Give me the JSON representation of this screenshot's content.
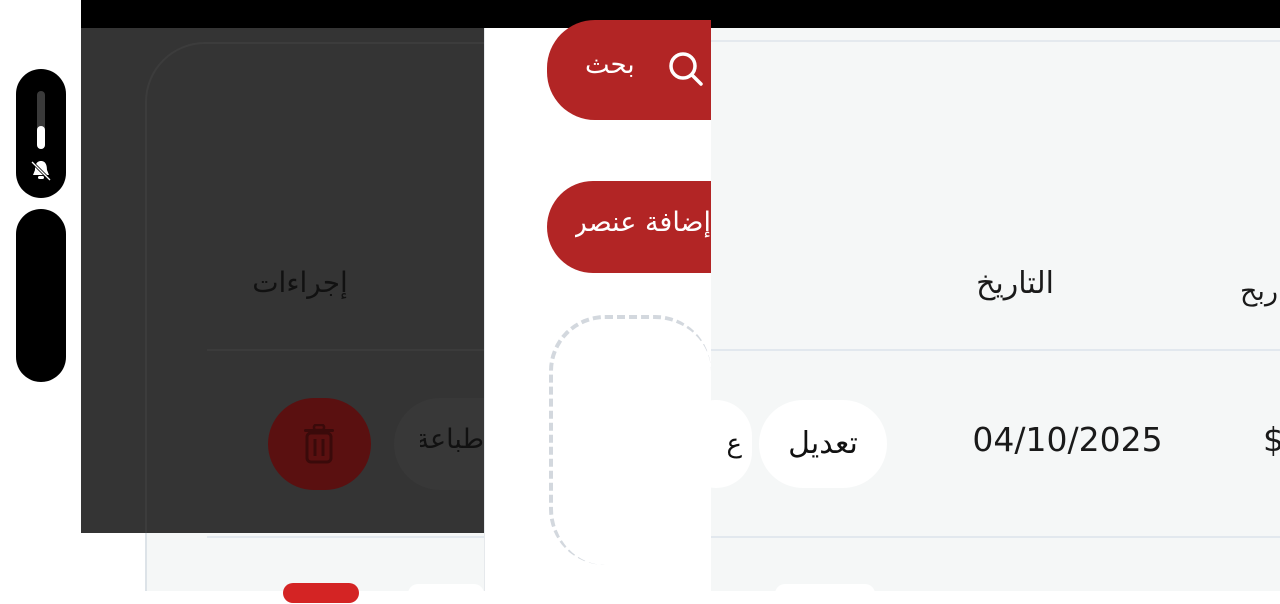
{
  "table": {
    "header_date": "التاريخ",
    "header_profit_partial": "ربح",
    "header_actions": "إجراءات",
    "row1_date": "04/10/2025",
    "row1_amount_partial": "$"
  },
  "buttons": {
    "search": "بحث",
    "add_item": "إضافة عنصر",
    "edit": "تعديل",
    "partial": "ع",
    "print_partial": "طباعة"
  },
  "icons": {
    "search": "search-icon",
    "delete": "trash-icon",
    "silent": "bell-off-icon"
  },
  "colors": {
    "accent_red": "#b22525",
    "overlay": "#343434",
    "card_bg": "#f5f7f7"
  },
  "system": {
    "volume_level": 0.4
  }
}
